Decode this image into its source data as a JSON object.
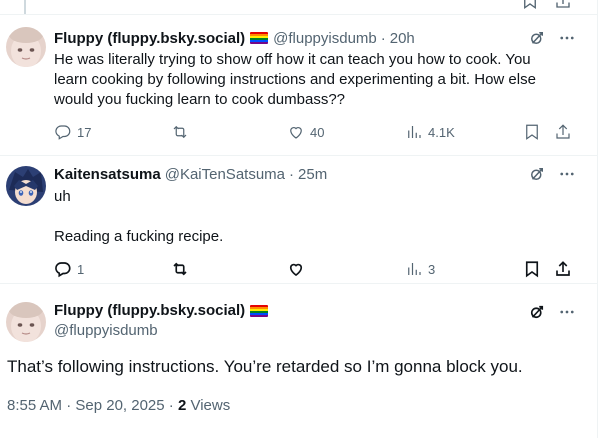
{
  "tweets": [
    {
      "name": "Fluppy (fluppy.bsky.social)",
      "handle": "@fluppyisdumb",
      "dot": "·",
      "time": "20h",
      "lines": [
        "He was literally trying to show off how it can teach you how to cook. You",
        "learn cooking by following instructions and experimenting a bit. How else",
        "would you fucking learn to cook dumbass??"
      ],
      "replies": "17",
      "likes": "40",
      "views": "4.1K"
    },
    {
      "name": "Kaitensatsuma",
      "handle": "@KaiTenSatsuma",
      "dot": "·",
      "time": "25m",
      "lines": [
        "uh",
        "",
        "Reading a fucking recipe."
      ],
      "replies": "1",
      "views": "3"
    }
  ],
  "main_tweet": {
    "name": "Fluppy (fluppy.bsky.social)",
    "handle": "@fluppyisdumb",
    "text": "That’s following instructions. You’re retarded so I’m gonna block you.",
    "timestamp": "8:55 AM · Sep 20, 2025",
    "separator": "·",
    "views_count": "2",
    "views_label": "Views"
  },
  "icons": {
    "grok": "grok-icon",
    "more": "more-icon",
    "reply": "reply-icon",
    "retweet": "retweet-icon",
    "like": "like-icon",
    "views": "views-icon",
    "bookmark": "bookmark-icon",
    "share": "share-icon",
    "flag": "rainbow-flag-icon"
  },
  "colors": {
    "text_primary": "#0f1419",
    "text_secondary": "#536471",
    "divider": "#eff3f4"
  }
}
